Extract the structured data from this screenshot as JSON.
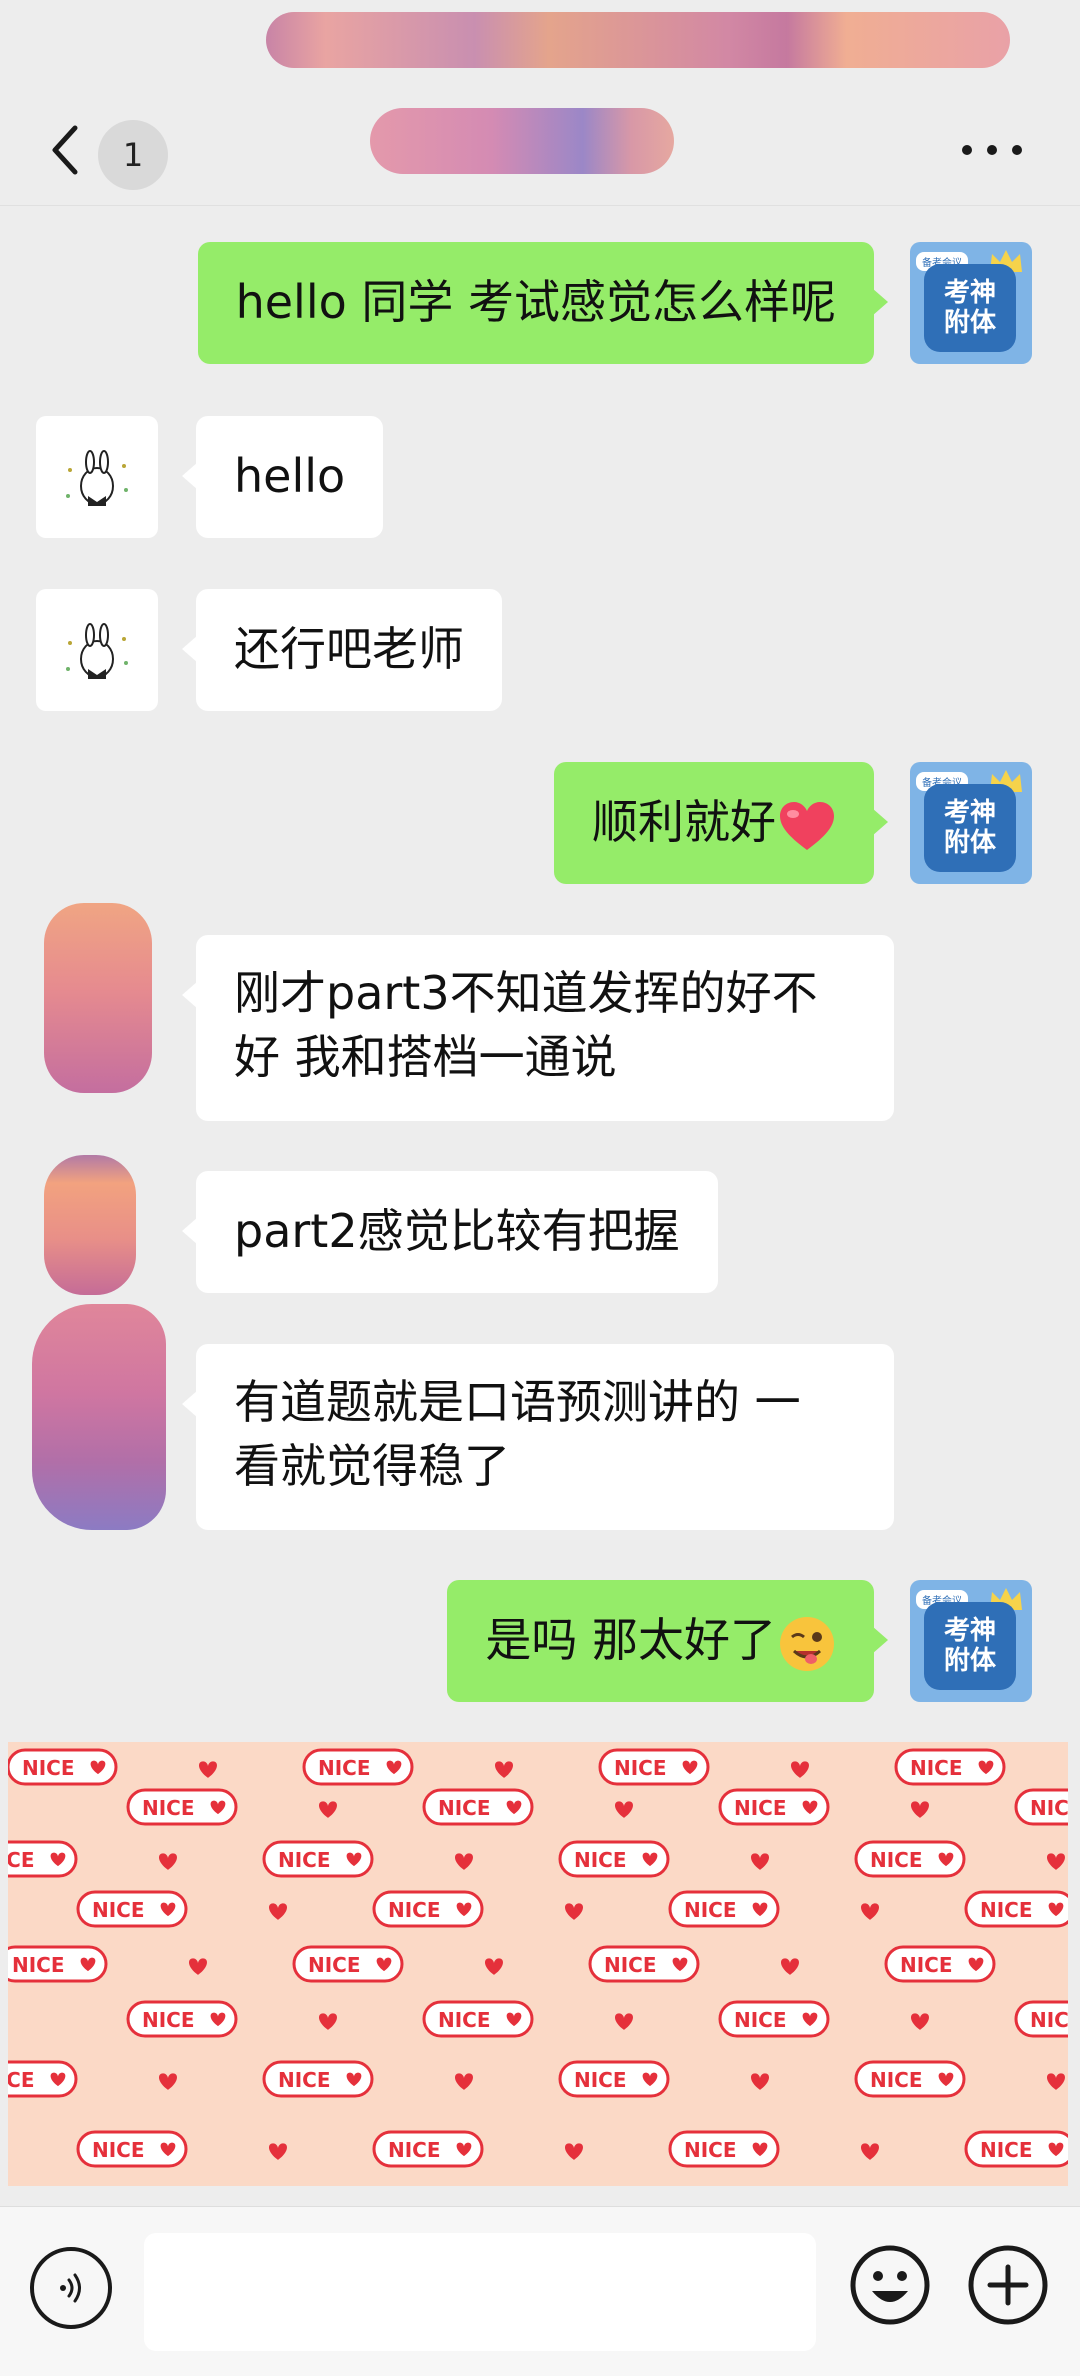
{
  "nav": {
    "unread_count": "1",
    "title_obscured": true
  },
  "messages": [
    {
      "side": "me",
      "text": "hello 同学 考试感觉怎么样呢"
    },
    {
      "side": "other",
      "text": "hello"
    },
    {
      "side": "other",
      "text": "还行吧老师"
    },
    {
      "side": "me",
      "text": "顺利就好",
      "emoji": "red-heart"
    },
    {
      "side": "other",
      "text_lines": [
        "刚才part3不知道发挥的好不",
        "好 我和搭档一通说"
      ]
    },
    {
      "side": "other",
      "text": "part2感觉比较有把握"
    },
    {
      "side": "other",
      "text_lines": [
        "有道题就是口语预测讲的 一",
        "看就觉得稳了"
      ]
    },
    {
      "side": "me",
      "text": "是吗 那太好了",
      "emoji": "winking-face-with-tongue"
    }
  ],
  "my_avatar": {
    "tag": "备考会议",
    "line1": "考神",
    "line2": "附体"
  },
  "sticker": {
    "label": "NICE",
    "background": "#fbd9c6",
    "accent": "#e5303b"
  },
  "colors": {
    "my_bubble": "#95ec69",
    "other_bubble": "#ffffff",
    "background": "#ededed"
  },
  "input": {
    "value": "",
    "placeholder": ""
  }
}
